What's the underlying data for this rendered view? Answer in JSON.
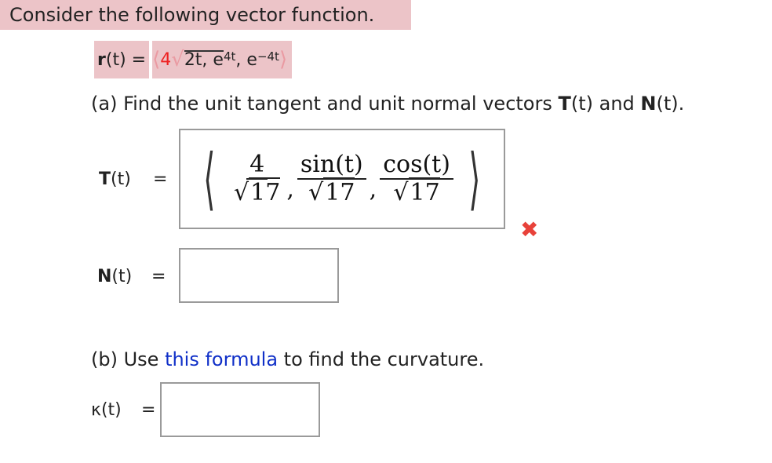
{
  "intro": "Consider the following vector function.",
  "vector_function": {
    "label_bold": "r",
    "label_arg": "(t) =",
    "open": "⟨",
    "coef": "4",
    "sqrt_sym": "√",
    "radicand_rest": "2t, e",
    "exp1": "4t",
    "mid": ", e",
    "exp2": "−4t",
    "close": "⟩"
  },
  "part_a": {
    "prefix": "(a) Find the unit tangent and unit normal vectors ",
    "T_bold": "T",
    "T_arg": "(t) and ",
    "N_bold": "N",
    "N_arg": "(t)."
  },
  "T_row": {
    "label_bold": "T",
    "label_arg": "(t)",
    "eq": "=",
    "answer": {
      "c1_num": "4",
      "c1_den": "17",
      "c2_num": "sin(t)",
      "c2_den": "17",
      "c3_num": "cos(t)",
      "c3_den": "17",
      "sqrt_sym": "√",
      "comma": ","
    },
    "status_icon": "incorrect-x-icon",
    "mark": "✖"
  },
  "N_row": {
    "label_bold": "N",
    "label_arg": "(t)",
    "eq": "=",
    "value": ""
  },
  "part_b": {
    "prefix": "(b) Use ",
    "link": "this formula",
    "suffix": " to find the curvature."
  },
  "kappa_row": {
    "label": "κ(t)",
    "eq": "=",
    "value": ""
  },
  "colors": {
    "highlight": "#ecc4c8",
    "link": "#1030c8",
    "error": "#e8423a"
  }
}
